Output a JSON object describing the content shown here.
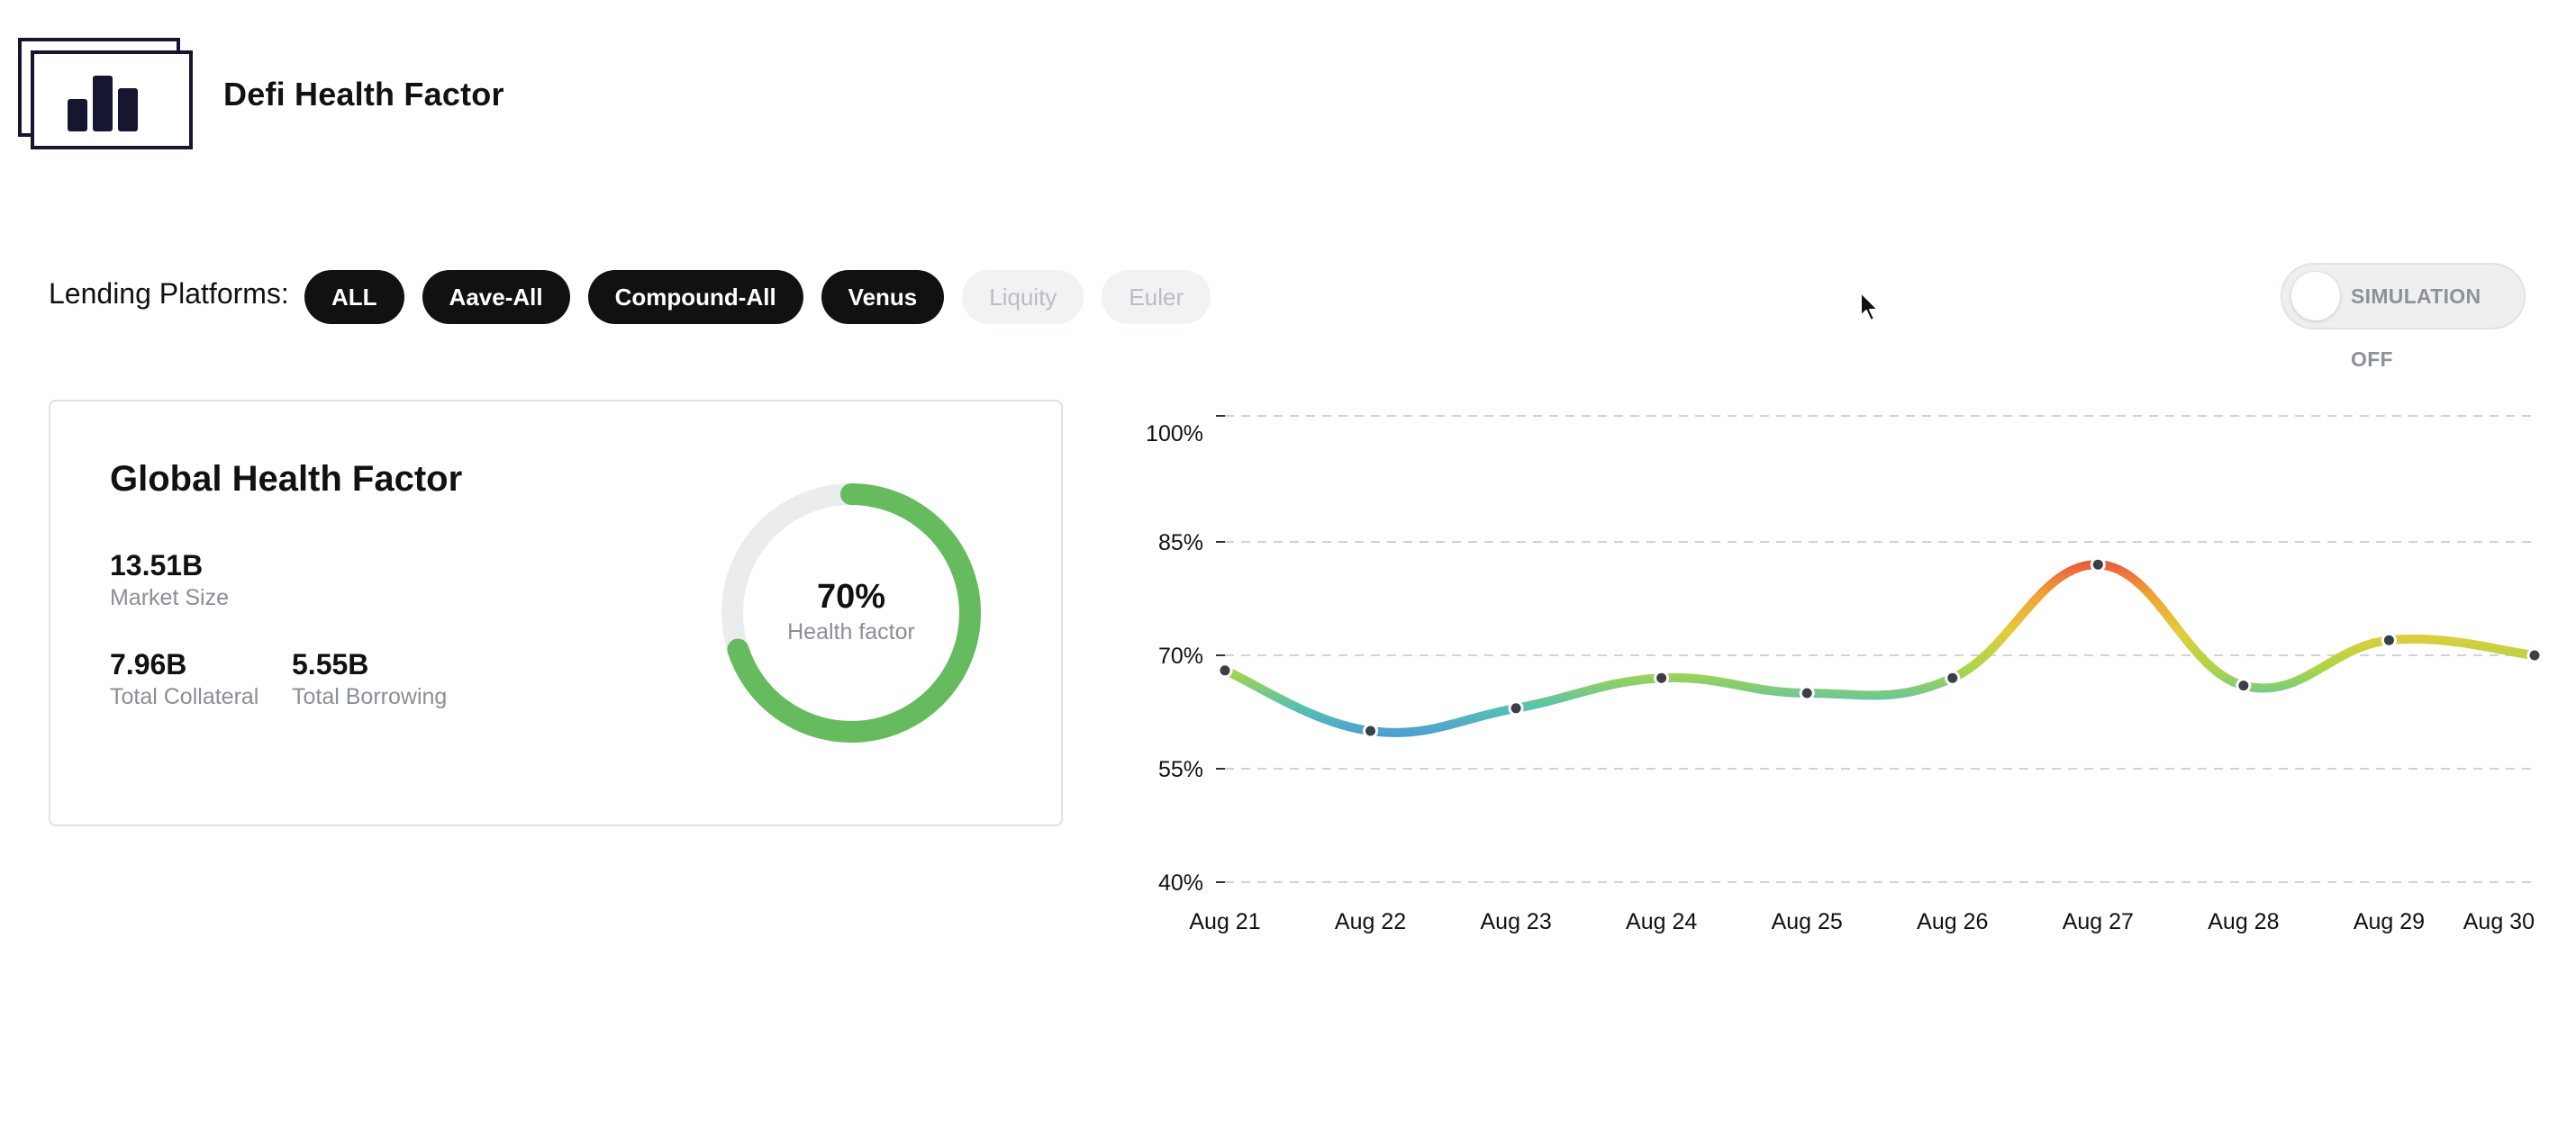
{
  "header": {
    "app_title": "Defi Health Factor",
    "logo_icon": "bar-chart-logo-icon"
  },
  "filters": {
    "label": "Lending Platforms:",
    "platforms": [
      {
        "label": "ALL",
        "active": true
      },
      {
        "label": "Aave-All",
        "active": true
      },
      {
        "label": "Compound-All",
        "active": true
      },
      {
        "label": "Venus",
        "active": true
      },
      {
        "label": "Liquity",
        "active": false
      },
      {
        "label": "Euler",
        "active": false
      }
    ]
  },
  "simulation": {
    "label": "SIMULATION OFF",
    "enabled": false
  },
  "card": {
    "title": "Global Health Factor",
    "market_size": {
      "value": "13.51B",
      "label": "Market Size"
    },
    "total_collateral": {
      "value": "7.96B",
      "label": "Total Collateral"
    },
    "total_borrowing": {
      "value": "5.55B",
      "label": "Total Borrowing"
    },
    "gauge": {
      "value_text": "70%",
      "label": "Health factor",
      "fraction": 0.7,
      "color": "#66bb5e",
      "track_color": "#ebecee"
    }
  },
  "chart_data": {
    "type": "line",
    "x": [
      "Aug 21",
      "Aug 22",
      "Aug 23",
      "Aug 24",
      "Aug 25",
      "Aug 26",
      "Aug 27",
      "Aug 28",
      "Aug 29",
      "Aug 30"
    ],
    "ytick_labels": [
      "100%",
      "85%",
      "70%",
      "55%",
      "40%"
    ],
    "yticks": [
      100,
      85,
      70,
      55,
      40
    ],
    "ylim": [
      40,
      100
    ],
    "grid": true,
    "series": [
      {
        "values": [
          68,
          60,
          63,
          67,
          65,
          67,
          82,
          66,
          72,
          70
        ]
      }
    ],
    "gradient_colors": [
      "#4a90e2",
      "#56c1b0",
      "#a8d54a",
      "#e3cd3c",
      "#f0a235",
      "#e8503f"
    ]
  }
}
